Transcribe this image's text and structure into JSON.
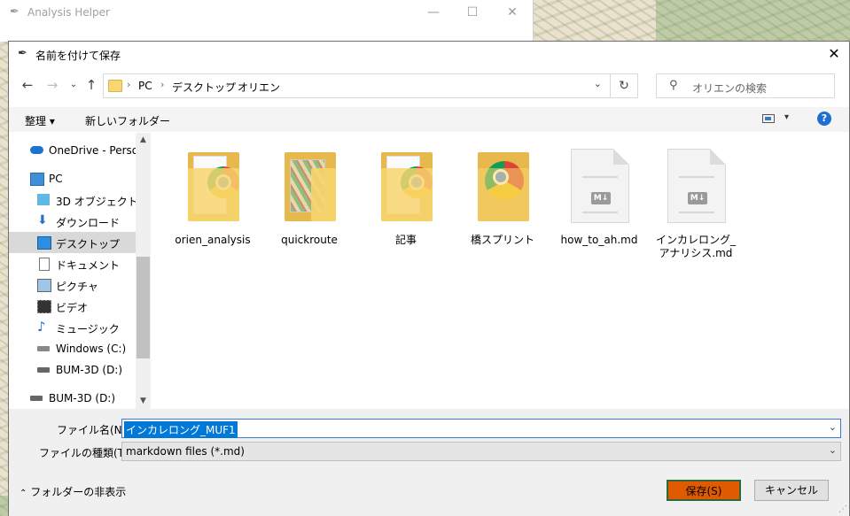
{
  "back_window": {
    "title": "Analysis Helper"
  },
  "dialog": {
    "title": "名前を付けて保存",
    "breadcrumb": [
      "PC",
      "デスクトップ",
      "オリエン"
    ],
    "search_placeholder": "オリエンの検索",
    "toolbar": {
      "organize": "整理 ▾",
      "new_folder": "新しいフォルダー"
    },
    "nav": [
      {
        "label": "OneDrive - Person",
        "icon": "onedrive-icon"
      },
      {
        "label": "PC",
        "icon": "pc-icon"
      },
      {
        "label": "3D オブジェクト",
        "icon": "3d-objects-icon"
      },
      {
        "label": "ダウンロード",
        "icon": "download-icon"
      },
      {
        "label": "デスクトップ",
        "icon": "desktop-icon"
      },
      {
        "label": "ドキュメント",
        "icon": "documents-icon"
      },
      {
        "label": "ピクチャ",
        "icon": "pictures-icon"
      },
      {
        "label": "ビデオ",
        "icon": "videos-icon"
      },
      {
        "label": "ミュージック",
        "icon": "music-icon"
      },
      {
        "label": "Windows (C:)",
        "icon": "drive-c-icon"
      },
      {
        "label": "BUM-3D (D:)",
        "icon": "drive-d-icon"
      },
      {
        "label": "BUM-3D (D:)",
        "icon": "drive-d-icon"
      }
    ],
    "files": [
      {
        "name": "orien_analysis",
        "kind": "folder-chrome"
      },
      {
        "name": "quickroute",
        "kind": "folder-map"
      },
      {
        "name": "記事",
        "kind": "folder-chrome"
      },
      {
        "name": "橋スプリント",
        "kind": "folder-chrome-full"
      },
      {
        "name": "how_to_ah.md",
        "kind": "md-file"
      },
      {
        "name": "インカレロング_アナリシス.md",
        "kind": "md-file"
      }
    ],
    "md_badge": "M↓",
    "filename_label": "ファイル名(N):",
    "filename_value": "インカレロング_MUF1",
    "filetype_label": "ファイルの種類(T):",
    "filetype_value": "markdown files (*.md)",
    "hide_folders": "フォルダーの非表示",
    "save_button": "保存(S)",
    "cancel_button": "キャンセル",
    "colors": {
      "save_button_bg": "#e05a00",
      "selection": "#0078d7",
      "help": "#1e6fcf"
    }
  }
}
